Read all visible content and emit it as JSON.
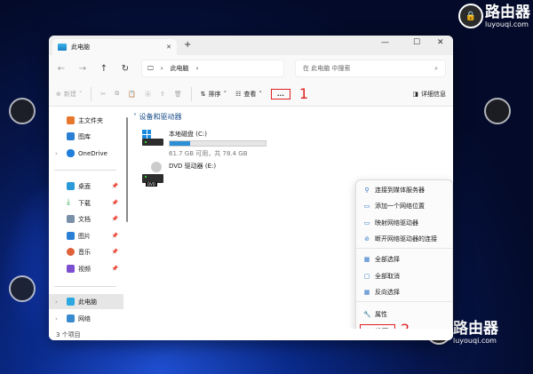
{
  "watermark": {
    "brand": "路由器",
    "site": "luyouqi.com"
  },
  "window": {
    "tab_title": "此电脑",
    "close_tab": "✕",
    "new_tab": "+",
    "minimize": "—",
    "maximize": "☐",
    "close": "✕"
  },
  "nav": {
    "back": "←",
    "forward": "→",
    "up": "↑",
    "refresh": "↻",
    "breadcrumb": "此电脑",
    "sep": "›",
    "search_placeholder": "在 此电脑 中搜索"
  },
  "toolbar": {
    "new": "新建",
    "sort": "排序",
    "view": "查看",
    "more": "...",
    "details": "详细信息",
    "annot1": "1"
  },
  "sidebar": {
    "quick": [
      {
        "label": "主文件夹",
        "color": "#e8772e"
      },
      {
        "label": "图库",
        "color": "#2a7fd4"
      },
      {
        "label": "OneDrive",
        "color": "#1f7fd9"
      }
    ],
    "pinned": [
      {
        "label": "桌面",
        "color": "#2a9ad8"
      },
      {
        "label": "下载",
        "color": "#2ba84a"
      },
      {
        "label": "文档",
        "color": "#7a8fa8"
      },
      {
        "label": "图片",
        "color": "#2a7fd4"
      },
      {
        "label": "音乐",
        "color": "#e0603a"
      },
      {
        "label": "视频",
        "color": "#7b4fd0"
      }
    ],
    "bottom": [
      {
        "label": "此电脑",
        "color": "#2aa8e0"
      },
      {
        "label": "网络",
        "color": "#3a8ad0"
      }
    ]
  },
  "content": {
    "group": "设备和驱动器",
    "drives": [
      {
        "name": "本地磁盘 (C:)",
        "free": "61.7 GB 可用，共 78.4 GB",
        "used_fraction": 0.21
      },
      {
        "name": "DVD 驱动器 (E:)",
        "badge": "DVD"
      }
    ]
  },
  "menu": {
    "items": [
      {
        "label": "连接到媒体服务器",
        "icon": "⚲"
      },
      {
        "label": "添加一个网络位置",
        "icon": "▭"
      },
      {
        "label": "映射网络驱动器",
        "icon": "▭"
      },
      {
        "label": "断开网络驱动器的连接",
        "icon": "⊘"
      },
      {
        "label": "全部选择",
        "icon": "▦"
      },
      {
        "label": "全部取消",
        "icon": "▢"
      },
      {
        "label": "反向选择",
        "icon": "▦"
      },
      {
        "label": "属性",
        "icon": "🔧"
      },
      {
        "label": "选项",
        "icon": "⚙"
      }
    ],
    "annot2": "2"
  },
  "status": {
    "count": "3 个项目"
  }
}
